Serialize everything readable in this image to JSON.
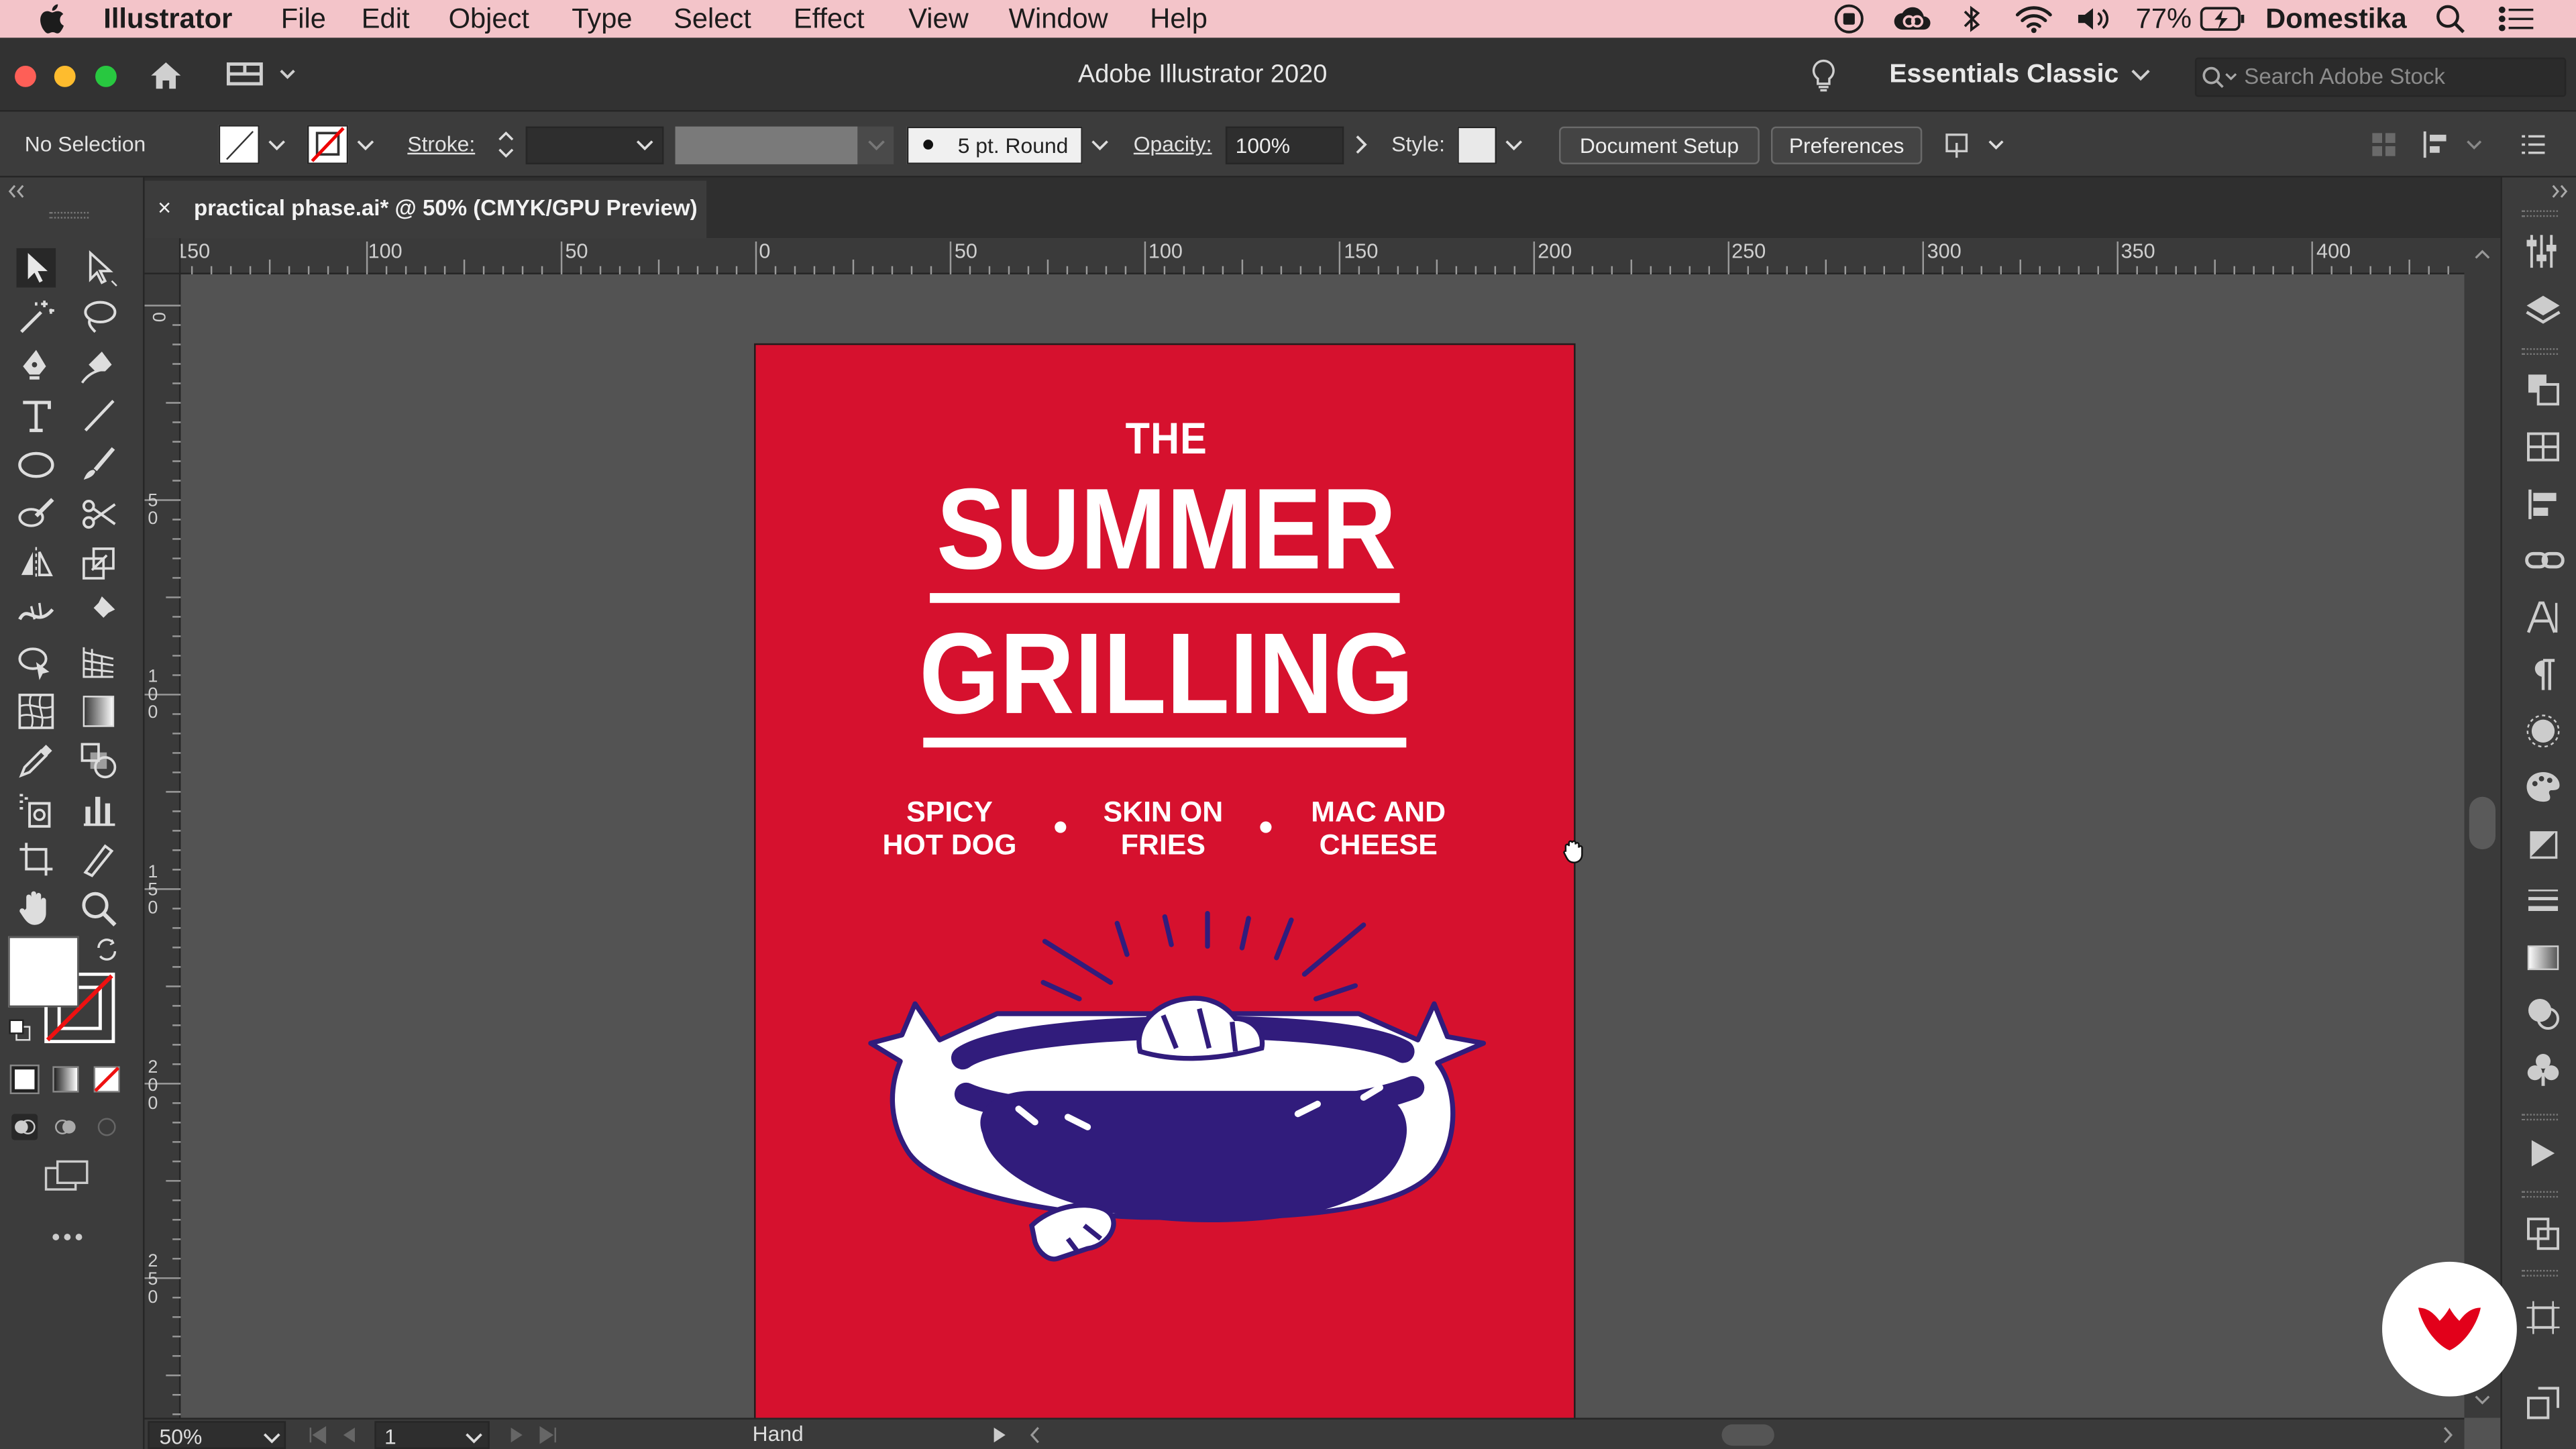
{
  "menubar": {
    "app_name": "Illustrator",
    "items": [
      "File",
      "Edit",
      "Object",
      "Type",
      "Select",
      "Effect",
      "View",
      "Window",
      "Help"
    ],
    "battery": "77%",
    "user": "Domestika"
  },
  "titlebar": {
    "window_title": "Adobe Illustrator 2020",
    "workspace": "Essentials Classic",
    "search_placeholder": "Search Adobe Stock"
  },
  "controlbar": {
    "selection": "No Selection",
    "stroke_label": "Stroke:",
    "brush": "5 pt. Round",
    "opacity_label": "Opacity:",
    "opacity_value": "100%",
    "style_label": "Style:",
    "document_setup": "Document Setup",
    "preferences": "Preferences"
  },
  "document_tab": {
    "close": "×",
    "title": "practical phase.ai* @ 50% (CMYK/GPU Preview)"
  },
  "rulers": {
    "horizontal": [
      "150",
      "100",
      "50",
      "0",
      "50",
      "100",
      "150",
      "200",
      "250",
      "300",
      "350",
      "400"
    ],
    "vertical": [
      "0",
      "50",
      "100",
      "150",
      "200",
      "250"
    ]
  },
  "statusbar": {
    "zoom": "50%",
    "artboard": "1",
    "tool": "Hand"
  },
  "poster": {
    "the": "THE",
    "line1": "SUMMER",
    "line2": "GRILLING",
    "items": [
      {
        "a": "SPICY",
        "b": "HOT DOG"
      },
      {
        "a": "SKIN ON",
        "b": "FRIES"
      },
      {
        "a": "MAC AND",
        "b": "CHEESE"
      }
    ]
  },
  "colors": {
    "poster_red": "#d6112e",
    "hotdog_purple": "#311c7c",
    "menubar_pink": "#f3c4c9",
    "domestika_red": "#e2001a"
  }
}
